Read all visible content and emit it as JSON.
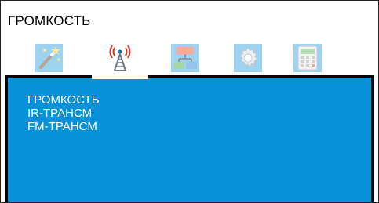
{
  "window": {
    "title": "ГРОМКОСТЬ"
  },
  "tabs": [
    {
      "icon": "magic-wand-icon",
      "state": "inactive"
    },
    {
      "icon": "antenna-tower-icon",
      "state": "active"
    },
    {
      "icon": "network-diagram-icon",
      "state": "inactive"
    },
    {
      "icon": "gear-icon",
      "state": "inactive"
    },
    {
      "icon": "calculator-icon",
      "state": "inactive"
    }
  ],
  "menu": {
    "items": [
      {
        "label": "ГРОМКОСТЬ"
      },
      {
        "label": "IR-ТРАНСМ"
      },
      {
        "label": "FM-ТРАНСМ"
      }
    ]
  },
  "colors": {
    "panel": "#0890d8",
    "tab_backdrop": "#2aa0e0",
    "text": "#ffffff"
  }
}
